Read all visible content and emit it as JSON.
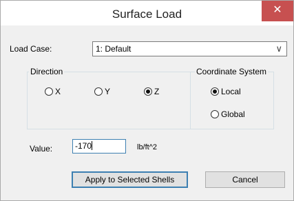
{
  "window": {
    "title": "Surface Load",
    "close_glyph": "✕"
  },
  "load_case": {
    "label": "Load Case:",
    "selected": "1: Default",
    "arrow": "∨"
  },
  "direction": {
    "title": "Direction",
    "options": [
      {
        "label": "X",
        "checked": false
      },
      {
        "label": "Y",
        "checked": false
      },
      {
        "label": "Z",
        "checked": true
      }
    ]
  },
  "coordinate_system": {
    "title": "Coordinate System",
    "options": [
      {
        "label": "Local",
        "checked": true
      },
      {
        "label": "Global",
        "checked": false
      }
    ]
  },
  "value": {
    "label": "Value:",
    "current": "-170",
    "unit": "lb/ft^2"
  },
  "buttons": {
    "apply": "Apply to Selected Shells",
    "cancel": "Cancel"
  }
}
